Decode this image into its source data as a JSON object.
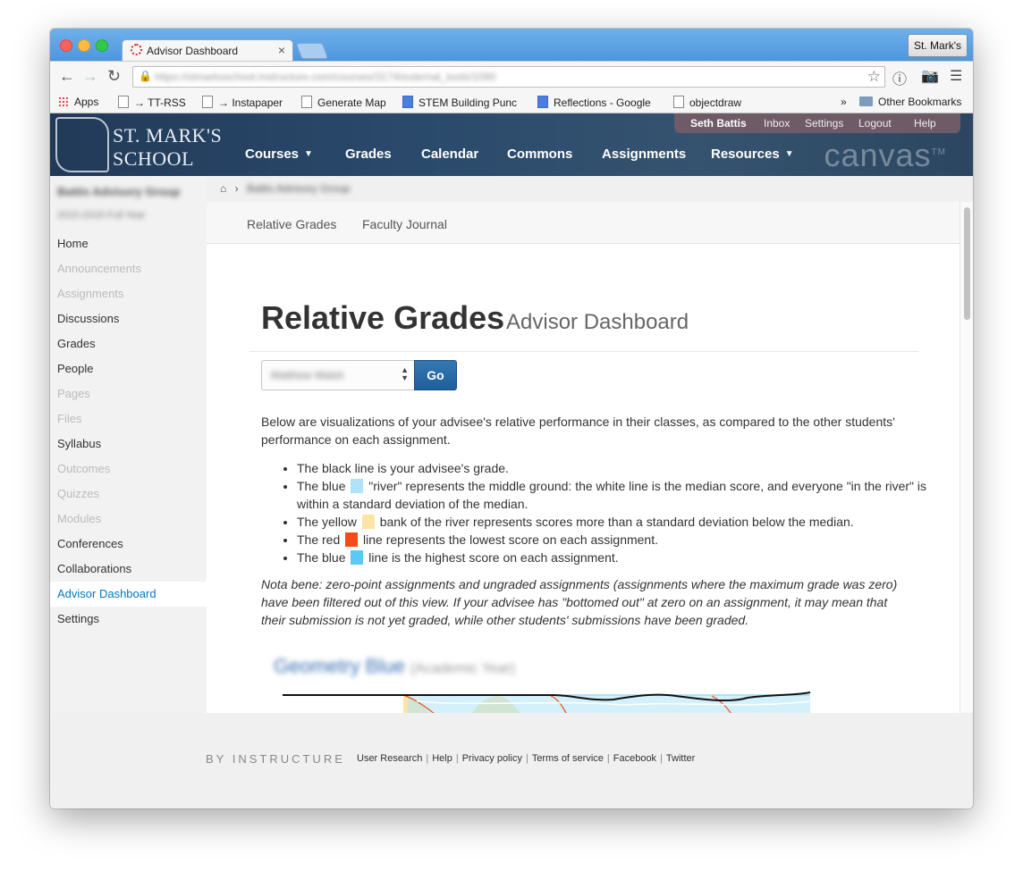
{
  "browser": {
    "tab_title": "Advisor Dashboard",
    "tab_close": "×",
    "profile": "St. Mark's",
    "url": "https://stmarksschool.instructure.com/courses/3174/external_tools/1090",
    "bookmarks": [
      "Apps",
      "→ TT-RSS",
      "→ Instapaper",
      "Generate Map",
      "STEM Building Punc",
      "Reflections - Google",
      "objectdraw",
      "»",
      "Other Bookmarks"
    ]
  },
  "header": {
    "logo_line1": "ST. MARK'S",
    "logo_line2": "SCHOOL",
    "user_menu": [
      "Seth Battis",
      "Inbox",
      "Settings",
      "Logout",
      "Help"
    ],
    "nav": [
      "Courses",
      "Grades",
      "Calendar",
      "Commons",
      "Assignments",
      "Resources"
    ],
    "wordmark": "canvas",
    "trademark": "TM"
  },
  "sidebar": {
    "course_name": "Battis Advisory Group",
    "term": "2015-2016 Full Year",
    "items": [
      {
        "label": "Home",
        "state": "normal"
      },
      {
        "label": "Announcements",
        "state": "disabled"
      },
      {
        "label": "Assignments",
        "state": "disabled"
      },
      {
        "label": "Discussions",
        "state": "normal"
      },
      {
        "label": "Grades",
        "state": "normal"
      },
      {
        "label": "People",
        "state": "normal"
      },
      {
        "label": "Pages",
        "state": "disabled"
      },
      {
        "label": "Files",
        "state": "disabled"
      },
      {
        "label": "Syllabus",
        "state": "normal"
      },
      {
        "label": "Outcomes",
        "state": "disabled"
      },
      {
        "label": "Quizzes",
        "state": "disabled"
      },
      {
        "label": "Modules",
        "state": "disabled"
      },
      {
        "label": "Conferences",
        "state": "normal"
      },
      {
        "label": "Collaborations",
        "state": "normal"
      },
      {
        "label": "Advisor Dashboard",
        "state": "active"
      },
      {
        "label": "Settings",
        "state": "normal"
      }
    ]
  },
  "breadcrumb": {
    "current": "Battis Advisory Group"
  },
  "subnav": [
    "Relative Grades",
    "Faculty Journal"
  ],
  "main": {
    "title": "Relative Grades",
    "subtitle": "Advisor Dashboard",
    "select_value": "Matthew Walsh",
    "go_label": "Go",
    "intro": "Below are visualizations of your advisee's relative performance in their classes, as compared to the other students' performance on each assignment.",
    "bullets": [
      {
        "before": "The black line is your advisee's grade.",
        "after": ""
      },
      {
        "before": "The blue",
        "after": "\"river\" represents the middle ground: the white line is the median score, and everyone \"in the river\" is within a standard deviation of the median."
      },
      {
        "before": "The yellow",
        "after": "bank of the river represents scores more than a standard deviation below the median."
      },
      {
        "before": "The red",
        "after": "line represents the lowest score on each assignment."
      },
      {
        "before": "The blue",
        "after": "line is the highest score on each assignment."
      }
    ],
    "note": "Nota bene: zero-point assignments and ungraded assignments (assignments where the maximum grade was zero) have been filtered out of this view. If your advisee has \"bottomed out\" at zero on an assignment, it may mean that their submission is not yet graded, while other students' submissions have been graded.",
    "chart_title": "Geometry Blue",
    "chart_subtitle": "(Academic Year)"
  },
  "colors": {
    "river_blue": "#aee3f8",
    "bank_yellow": "#fde4a6",
    "low_red": "#f24b16",
    "high_blue": "#5bc8f5",
    "accent": "#0079c1"
  },
  "footer": {
    "brand": "BY INSTRUCTURE",
    "links": [
      "User Research",
      "Help",
      "Privacy policy",
      "Terms of service",
      "Facebook",
      "Twitter"
    ]
  }
}
